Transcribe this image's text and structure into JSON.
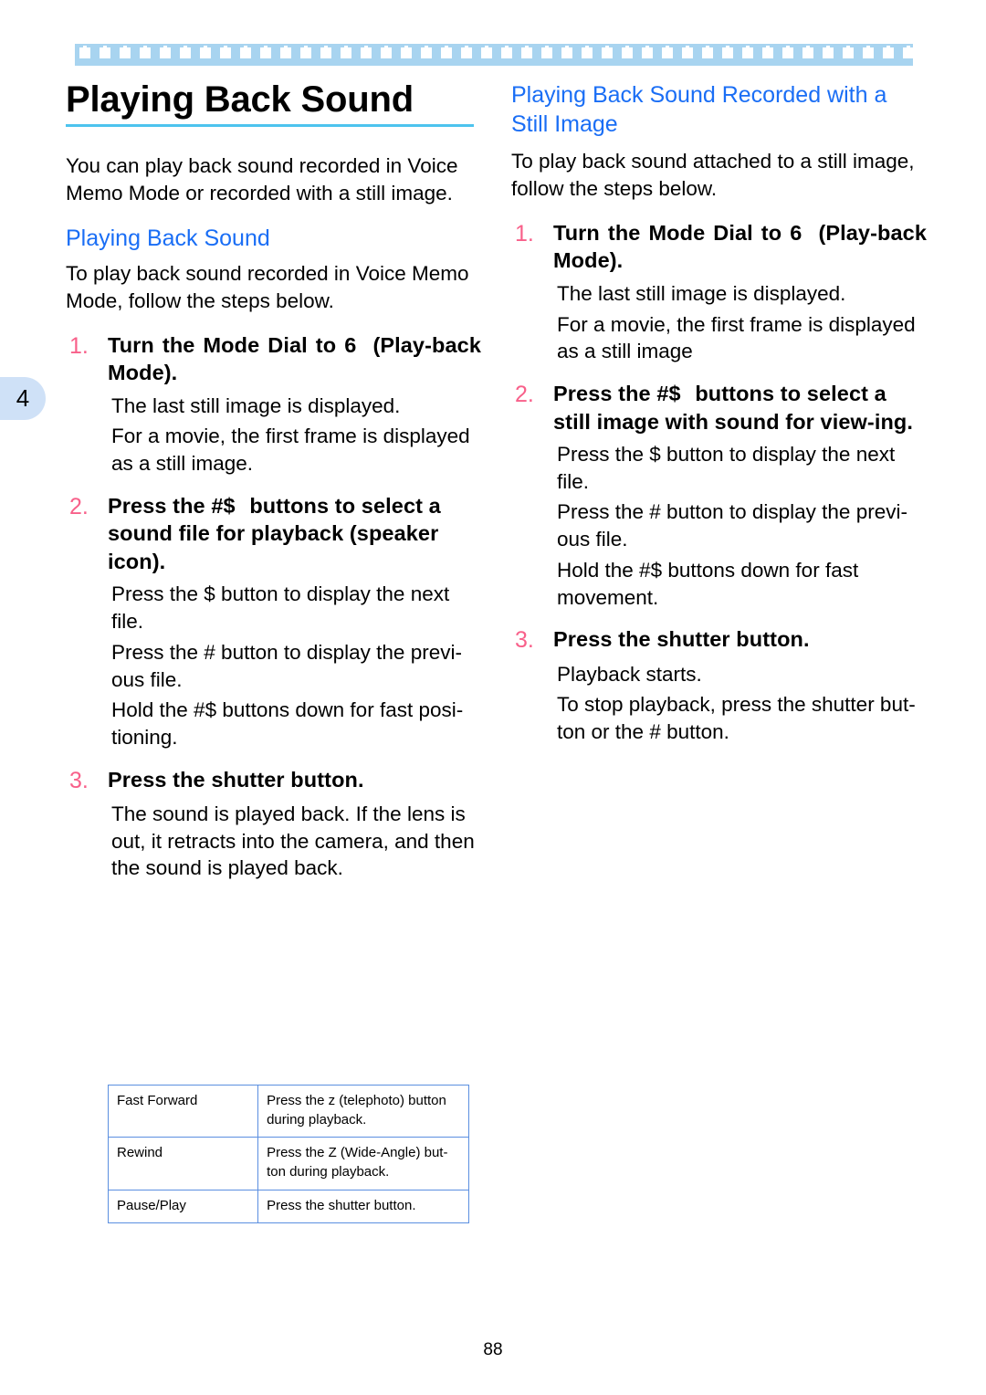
{
  "page": {
    "number": "88",
    "chapter_tab": "4",
    "accent_blue": "#1a6ef5",
    "rule_blue": "#4dc3ee",
    "band_blue": "#a8d4f0",
    "tab_blue": "#cfe1f7",
    "step_pink": "#f8608a",
    "table_border": "#5b8fe0"
  },
  "left": {
    "title": "Playing Back Sound",
    "intro": "You can play back sound recorded in Voice Memo Mode or recorded with a still image.",
    "section_heading": "Playing Back Sound",
    "section_intro": "To play back sound recorded in Voice Memo Mode, follow the steps below.",
    "steps": [
      {
        "num": "1.",
        "title_a": "Turn the Mode Dial to 6",
        "title_b": "(Play-back Mode).",
        "lines": [
          "The last still image is displayed.",
          "For a movie, the first frame is displayed as a still image."
        ]
      },
      {
        "num": "2.",
        "title_a": "Press the #$",
        "title_b": "buttons to select a sound file for playback (speaker icon).",
        "lines": [
          "Press the $  button to display the next file.",
          "Press the #  button to display the previ-ous file.",
          "Hold the #$   buttons down for fast posi-tioning."
        ]
      },
      {
        "num": "3.",
        "title_a": "Press the shutter button.",
        "title_b": "",
        "lines": [
          "The sound is played back. If the lens is out, it retracts into the camera, and then the sound is played back."
        ]
      }
    ]
  },
  "right": {
    "section_heading": "Playing Back Sound Recorded with a Still Image",
    "section_intro": "To play back sound attached to a still image, follow the steps below.",
    "steps": [
      {
        "num": "1.",
        "title_a": "Turn the Mode Dial to 6",
        "title_b": "(Play-back Mode).",
        "lines": [
          "The last still image is displayed.",
          "For a movie, the first frame is displayed as a still image"
        ]
      },
      {
        "num": "2.",
        "title_a": "Press the #$",
        "title_b": "buttons to select a still image with sound for view-ing.",
        "lines": [
          "Press the $  button to display the next file.",
          "Press the #  button to display the previ-ous file.",
          "Hold the #$   buttons down for fast movement."
        ]
      },
      {
        "num": "3.",
        "title_a": "Press the shutter button.",
        "title_b": "",
        "lines": [
          "Playback starts.",
          "To stop playback, press the shutter but-ton or the #  button."
        ]
      }
    ]
  },
  "table": {
    "rows": [
      {
        "operation": "Fast Forward",
        "instruction": "Press the z   (telephoto) button during playback."
      },
      {
        "operation": "Rewind",
        "instruction": "Press the Z   (Wide-Angle) but-ton during playback."
      },
      {
        "operation": "Pause/Play",
        "instruction": "Press the shutter button."
      }
    ]
  }
}
